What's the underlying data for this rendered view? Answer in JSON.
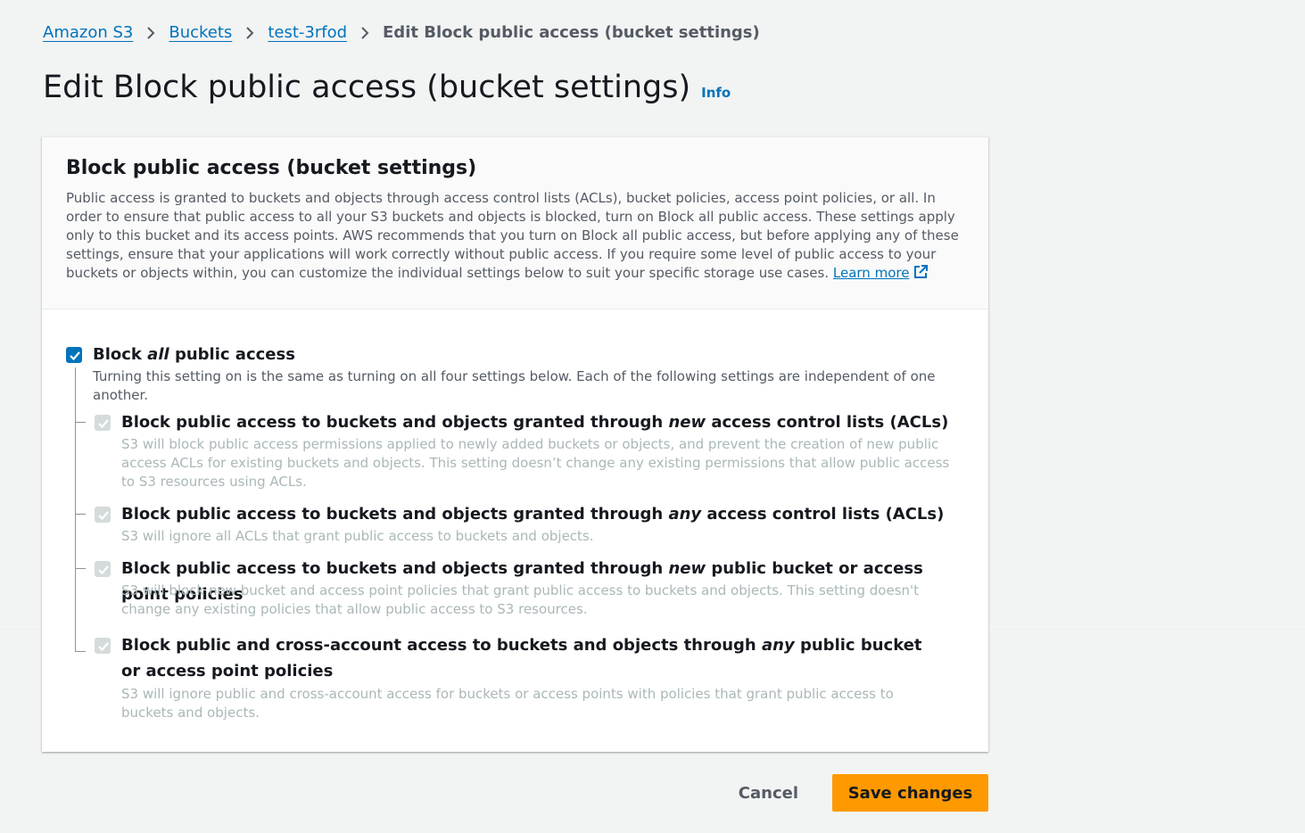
{
  "breadcrumb": {
    "items": [
      "Amazon S3",
      "Buckets",
      "test-3rfod"
    ],
    "current": "Edit Block public access (bucket settings)"
  },
  "page": {
    "title": "Edit Block public access (bucket settings)",
    "info_label": "Info"
  },
  "section": {
    "title": "Block public access (bucket settings)",
    "description": "Public access is granted to buckets and objects through access control lists (ACLs), bucket policies, access point policies, or all. In order to ensure that public access to all your S3 buckets and objects is blocked, turn on Block all public access. These settings apply only to this bucket and its access points. AWS recommends that you turn on Block all public access, but before applying any of these settings, ensure that your applications will work correctly without public access. If you require some level of public access to your buckets or objects within, you can customize the individual settings below to suit your specific storage use cases.",
    "learn_more": "Learn more"
  },
  "block_all": {
    "label_pre": "Block ",
    "label_em": "all",
    "label_post": " public access",
    "checked": true,
    "description": "Turning this setting on is the same as turning on all four settings below. Each of the following settings are independent of one another."
  },
  "options": [
    {
      "label_pre": "Block public access to buckets and objects granted through ",
      "label_em": "new",
      "label_post": " access control lists (ACLs)",
      "description": "S3 will block public access permissions applied to newly added buckets or objects, and prevent the creation of new public access ACLs for existing buckets and objects. This setting doesn’t change any existing permissions that allow public access to S3 resources using ACLs.",
      "checked": true
    },
    {
      "label_pre": "Block public access to buckets and objects granted through ",
      "label_em": "any",
      "label_post": " access control lists (ACLs)",
      "description": "S3 will ignore all ACLs that grant public access to buckets and objects.",
      "checked": true
    },
    {
      "label_pre": "Block public access to buckets and objects granted through ",
      "label_em": "new",
      "label_post": " public bucket or access point policies",
      "description": "S3 will block new bucket and access point policies that grant public access to buckets and objects. This setting doesn't change any existing policies that allow public access to S3 resources.",
      "checked": true
    },
    {
      "label_pre": "Block public and cross-account access to buckets and objects through ",
      "label_em": "any",
      "label_post": " public bucket or access point policies",
      "description": "S3 will ignore public and cross-account access for buckets or access points with policies that grant public access to buckets and objects.",
      "checked": true
    }
  ],
  "actions": {
    "cancel": "Cancel",
    "save": "Save changes"
  },
  "colors": {
    "link": "#0073bb",
    "primary_button": "#ff9900",
    "background": "#f2f3f3"
  }
}
